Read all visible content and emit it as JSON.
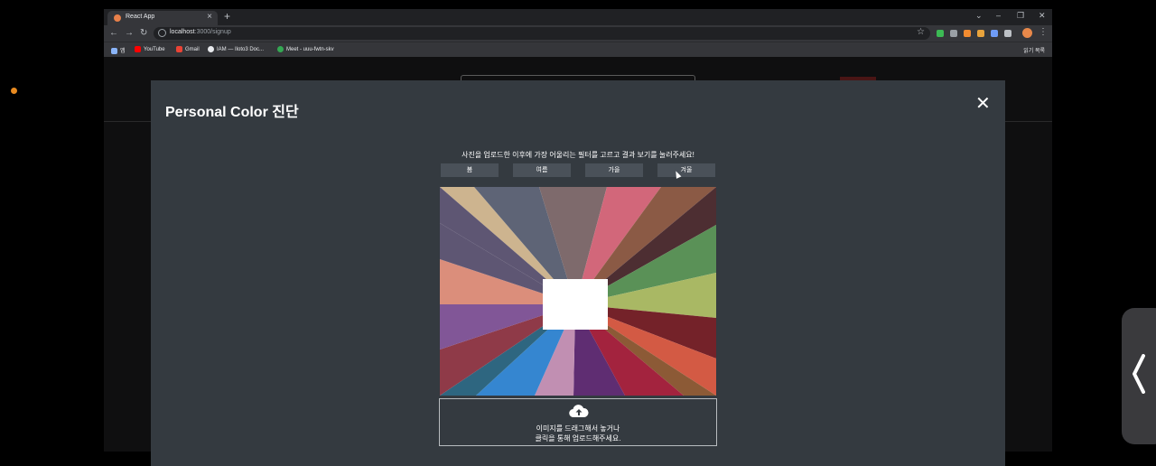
{
  "browser": {
    "tab_title": "React App",
    "tab_close": "×",
    "new_tab": "+",
    "url_host": "localhost",
    "url_path": ":3000/signup",
    "bookmarks": [
      "앱",
      "YouTube",
      "Gmail",
      "IAM — Iloto3 Doc...",
      "Meet - uuu-fwtn-skv"
    ],
    "reading_list": "읽기 목록",
    "window_controls": [
      "⌄",
      "–",
      "❐",
      "✕"
    ]
  },
  "modal": {
    "title": "Personal Color 진단",
    "close_label": "✕",
    "instruction": "사진을 업로드한 이후에 가장 어울리는 필터를 고르고 결과 보기를 눌러주세요!",
    "season_buttons": [
      "봄",
      "여름",
      "가을",
      "겨울"
    ],
    "upload_line1": "이미지를 드래그해서 놓거나",
    "upload_line2": "클릭을 통해 업로드해주세요."
  },
  "colors": {
    "modal_bg": "#343a40",
    "button_bg": "#4a5159",
    "page_bg": "#0f0f10",
    "palette": [
      "#cdb48f",
      "#5e6476",
      "#7e6a6c",
      "#d2677a",
      "#8b5a45",
      "#4d2e32",
      "#5a9157",
      "#a9b864",
      "#742229",
      "#d35a44",
      "#8c5a36",
      "#a3233e",
      "#5f2d72",
      "#c18fb2",
      "#3586d0",
      "#2e6680",
      "#8f3a48",
      "#815697",
      "#db8e7b",
      "#5e5673"
    ]
  }
}
